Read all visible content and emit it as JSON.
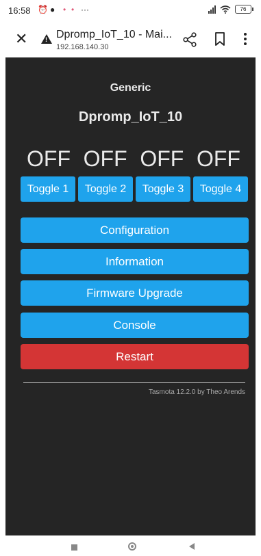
{
  "status_bar": {
    "time": "16:58",
    "battery": "76"
  },
  "browser": {
    "title": "Dpromp_IoT_10 - Mai...",
    "url": "192.168.140.30"
  },
  "page": {
    "module": "Generic",
    "device_name": "Dpromp_IoT_10",
    "states": [
      "OFF",
      "OFF",
      "OFF",
      "OFF"
    ],
    "toggles": [
      "Toggle 1",
      "Toggle 2",
      "Toggle 3",
      "Toggle 4"
    ],
    "menu": {
      "configuration": "Configuration",
      "information": "Information",
      "firmware_upgrade": "Firmware Upgrade",
      "console": "Console",
      "restart": "Restart"
    },
    "footer": "Tasmota 12.2.0 by Theo Arends"
  },
  "colors": {
    "button": "#1fa3ec",
    "restart": "#d43535",
    "background": "#252525"
  }
}
